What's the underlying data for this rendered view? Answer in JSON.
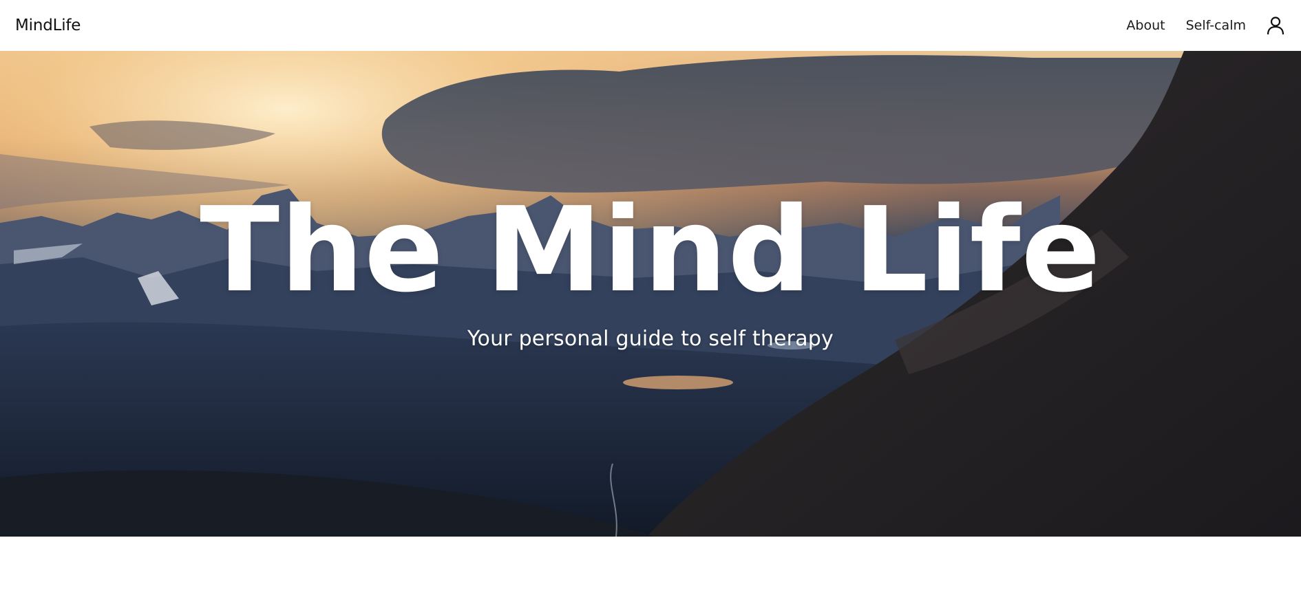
{
  "navbar": {
    "brand": "MindLife",
    "links": [
      "About",
      "Self-calm"
    ],
    "account_icon": "user-icon"
  },
  "hero": {
    "title": "The Mind Life",
    "subtitle": "Your personal guide to self therapy",
    "background": "mountain-sunset-photo"
  },
  "colors": {
    "navbar_bg": "#ffffff",
    "text_dark": "#111111",
    "hero_text": "#ffffff"
  }
}
